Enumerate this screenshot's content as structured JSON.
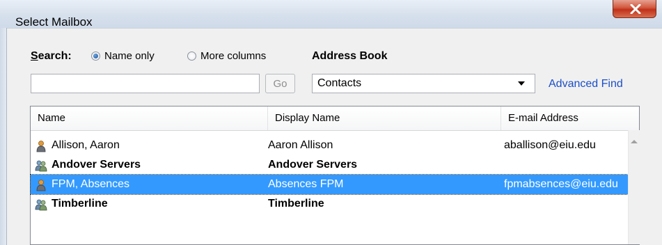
{
  "window": {
    "title": "Select Mailbox"
  },
  "search": {
    "label": "Search:",
    "radio_name_only": "Name only",
    "radio_more_columns": "More columns",
    "input_value": "",
    "go_label": "Go"
  },
  "address_book": {
    "label": "Address Book",
    "selected": "Contacts",
    "advanced_find": "Advanced Find"
  },
  "columns": [
    "Name",
    "Display Name",
    "E-mail Address"
  ],
  "rows": [
    {
      "name": "Allison, Aaron",
      "display": "Aaron Allison",
      "email": "aballison@eiu.edu",
      "type": "user"
    },
    {
      "name": "Andover Servers",
      "display": "Andover Servers",
      "email": "",
      "type": "group"
    },
    {
      "name": "FPM, Absences",
      "display": "Absences FPM",
      "email": "fpmabsences@eiu.edu",
      "type": "user"
    },
    {
      "name": "Timberline",
      "display": "Timberline",
      "email": "",
      "type": "group"
    }
  ],
  "colors": {
    "selection": "#3399ff",
    "link": "#1a4ec7",
    "close_button": "#c0311a"
  }
}
